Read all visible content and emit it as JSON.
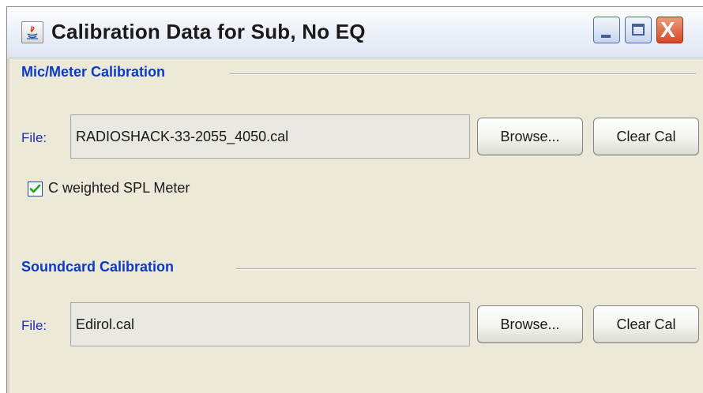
{
  "window": {
    "title": "Calibration Data for Sub, No EQ",
    "controls": {
      "minimize": "_",
      "maximize": "□",
      "close": "X"
    }
  },
  "mic_section": {
    "title": "Mic/Meter Calibration",
    "file_label": "File:",
    "file_value": "RADIOSHACK-33-2055_4050.cal",
    "browse_label": "Browse...",
    "clear_label": "Clear Cal",
    "checkbox_label": "C weighted SPL Meter",
    "checkbox_checked": true
  },
  "soundcard_section": {
    "title": "Soundcard Calibration",
    "file_label": "File:",
    "file_value": "Edirol.cal",
    "browse_label": "Browse...",
    "clear_label": "Clear Cal"
  },
  "colors": {
    "section_title": "#0a3ac8",
    "file_label": "#1f2bb7",
    "window_bg": "#ece9d8",
    "checkmark": "#21a121"
  },
  "icons": [
    "java-app-icon",
    "minimize-icon",
    "maximize-icon",
    "close-icon",
    "checkmark-icon"
  ]
}
